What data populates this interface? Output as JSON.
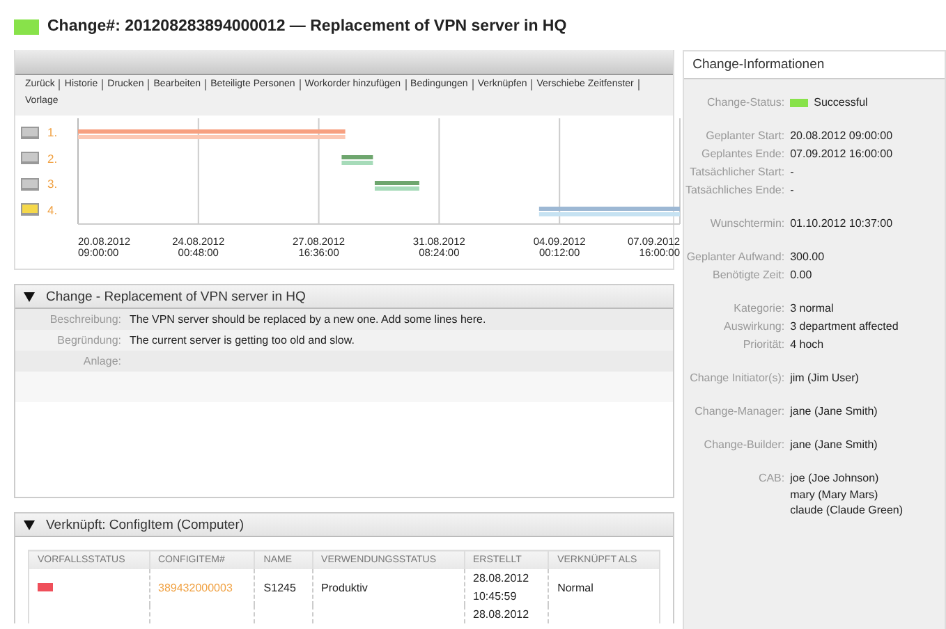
{
  "header": {
    "color": "#88e24a",
    "title": "Change#: 201208283894000012 — Replacement of VPN server in HQ"
  },
  "actions": [
    {
      "label": "Zurück"
    },
    {
      "label": "Historie"
    },
    {
      "label": "Drucken"
    },
    {
      "label": "Bearbeiten"
    },
    {
      "label": "Beteiligte Personen"
    },
    {
      "label": "Workorder hinzufügen"
    },
    {
      "label": "Bedingungen"
    },
    {
      "label": "Verknüpfen"
    },
    {
      "label": "Verschiebe Zeitfenster"
    },
    {
      "label": "Vorlage"
    }
  ],
  "timeline": {
    "workorders": [
      {
        "label": "1.",
        "color": "#c8c8c8"
      },
      {
        "label": "2.",
        "color": "#c8c8c8"
      },
      {
        "label": "3.",
        "color": "#c8c8c8"
      },
      {
        "label": "4.",
        "color": "#f5d84a"
      }
    ],
    "ticks": [
      [
        "20.08.2012",
        "09:00:00"
      ],
      [
        "24.08.2012",
        "00:48:00"
      ],
      [
        "27.08.2012",
        "16:36:00"
      ],
      [
        "31.08.2012",
        "08:24:00"
      ],
      [
        "04.09.2012",
        "00:12:00"
      ],
      [
        "07.09.2012",
        "16:00:00"
      ]
    ]
  },
  "change_section": {
    "title": "Change - Replacement of VPN server in HQ",
    "expanded": true,
    "fields": [
      {
        "label": "Beschreibung:",
        "value": "The VPN server should be replaced by a new one. Add some lines here."
      },
      {
        "label": "Begründung:",
        "value": "The current server is getting too old and slow."
      },
      {
        "label": "Anlage:"
      }
    ]
  },
  "linked_section": {
    "title": "Verknüpft: ConfigItem (Computer)",
    "expanded": true,
    "table": {
      "columns": [
        "VORFALLSSTATUS",
        "CONFIGITEM#",
        "NAME",
        "VERWENDUNGSSTATUS",
        "ERSTELLT",
        "VERKNÜPFT ALS"
      ],
      "rows": [
        {
          "color": "#ef4f5a",
          "configitem": "389432000003",
          "name": "S1245",
          "usage": "Produktiv",
          "created": [
            "28.08.2012",
            "10:45:59"
          ],
          "linked_as": "Normal"
        },
        {
          "created": [
            "28.08.2012"
          ]
        }
      ]
    }
  },
  "info_panel": {
    "title": "Change-Informationen",
    "groups": [
      [
        {
          "label": "Change-Status:",
          "values": [
            "Successful"
          ],
          "color": "#88e24a"
        }
      ],
      [
        {
          "label": "Geplanter Start:",
          "values": [
            "20.08.2012 09:00:00"
          ]
        },
        {
          "label": "Geplantes Ende:",
          "values": [
            "07.09.2012 16:00:00"
          ]
        },
        {
          "label": "Tatsächlicher Start:",
          "values": [
            "-"
          ]
        },
        {
          "label": "Tatsächliches Ende:",
          "values": [
            "-"
          ]
        }
      ],
      [
        {
          "label": "Wunschtermin:",
          "values": [
            "01.10.2012 10:37:00"
          ]
        }
      ],
      [
        {
          "label": "Geplanter Aufwand:",
          "values": [
            "300.00"
          ]
        },
        {
          "label": "Benötigte Zeit:",
          "values": [
            "0.00"
          ]
        }
      ],
      [
        {
          "label": "Kategorie:",
          "values": [
            "3 normal"
          ]
        },
        {
          "label": "Auswirkung:",
          "values": [
            "3 department affected"
          ]
        },
        {
          "label": "Priorität:",
          "values": [
            "4 hoch"
          ]
        }
      ],
      [
        {
          "label": "Change Initiator(s):",
          "values": [
            "jim (Jim User)"
          ]
        }
      ],
      [
        {
          "label": "Change-Manager:",
          "values": [
            "jane (Jane Smith)"
          ]
        }
      ],
      [
        {
          "label": "Change-Builder:",
          "values": [
            "jane (Jane Smith)"
          ]
        }
      ],
      [
        {
          "label": "CAB:",
          "values": [
            "joe (Joe Johnson)",
            "mary (Mary Mars)",
            "claude (Claude Green)"
          ]
        }
      ]
    ]
  }
}
